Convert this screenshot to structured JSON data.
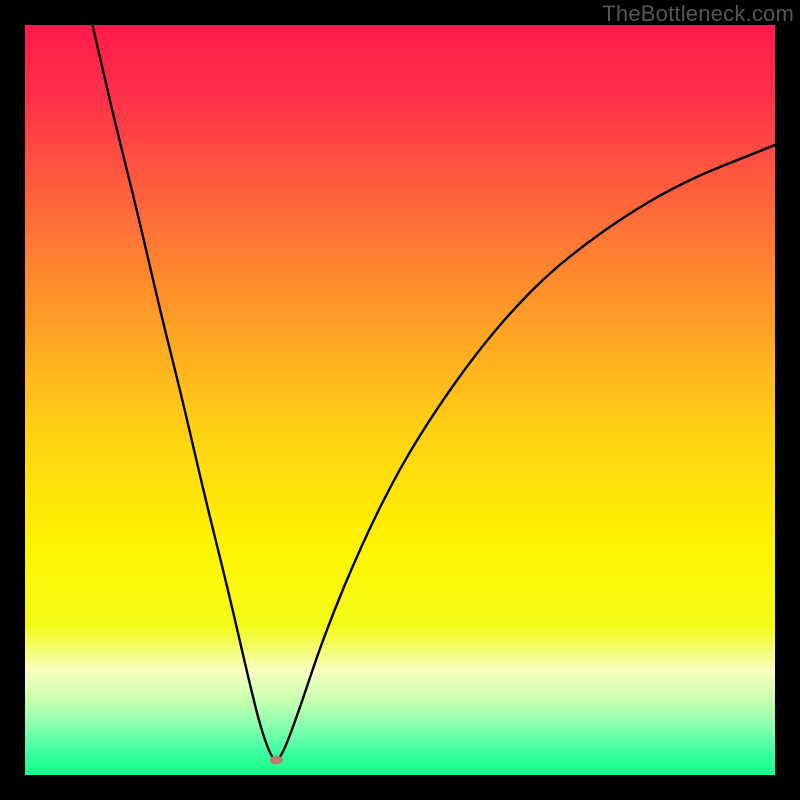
{
  "watermark": "TheBottleneck.com",
  "chart_data": {
    "type": "line",
    "title": "",
    "xlabel": "",
    "ylabel": "",
    "xlim": [
      0,
      100
    ],
    "ylim": [
      0,
      100
    ],
    "optimal_x": 33,
    "series": [
      {
        "name": "bottleneck-curve",
        "x": [
          9,
          12,
          15,
          18,
          21,
          24,
          27,
          30,
          31.5,
          33,
          34,
          36,
          40,
          45,
          50,
          55,
          60,
          65,
          70,
          75,
          80,
          85,
          90,
          95,
          100
        ],
        "values": [
          100,
          87,
          75,
          62,
          50,
          37,
          25,
          12,
          6,
          2,
          2,
          7,
          19,
          31,
          41,
          49,
          56,
          62,
          67,
          71,
          74.5,
          77.5,
          80,
          82,
          84
        ]
      }
    ],
    "marker": {
      "x": 33.5,
      "y": 2,
      "rx": 6.5,
      "ry": 4.5,
      "color": "#b9806f"
    },
    "gradient_stops": [
      {
        "offset": 0,
        "color": "#ff1a4b"
      },
      {
        "offset": 0.1,
        "color": "#ff3249"
      },
      {
        "offset": 0.25,
        "color": "#ff6a3a"
      },
      {
        "offset": 0.4,
        "color": "#ffa126"
      },
      {
        "offset": 0.55,
        "color": "#ffd413"
      },
      {
        "offset": 0.7,
        "color": "#fff500"
      },
      {
        "offset": 0.8,
        "color": "#f2fb17"
      },
      {
        "offset": 0.86,
        "color": "#f9ffbf"
      },
      {
        "offset": 0.9,
        "color": "#c8ffb0"
      },
      {
        "offset": 0.94,
        "color": "#7dffad"
      },
      {
        "offset": 0.97,
        "color": "#3bffa0"
      },
      {
        "offset": 1.0,
        "color": "#12ff88"
      }
    ]
  }
}
